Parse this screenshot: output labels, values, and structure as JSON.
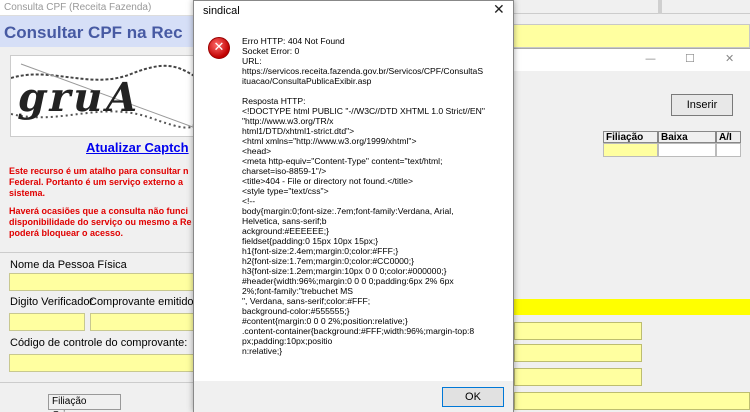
{
  "bg_window": {
    "inserir_label": "Inserir",
    "grid_headers": [
      "Filiação",
      "Baixa",
      "A/I"
    ],
    "minimize": "—",
    "maximize": "☐",
    "close": "✕",
    "filiacao_origem_label": "Filiação Origem"
  },
  "left_window": {
    "title": "Consulta CPF (Receita Fazenda)",
    "heading": "Consultar CPF na Rec",
    "captcha_text": "gruA",
    "refresh_link": "Atualizar Captch",
    "warning1": "Este recurso é um atalho para consultar n\nFederal. Portanto é um serviço externo a\nsistema.",
    "warning2": "Haverá ocasiões que a consulta não funci\ndisponibilidade do serviço ou mesmo a Re\npoderá bloquear o acesso.",
    "name_label": "Nome da Pessoa Física",
    "digit_label": "Digito Verificador",
    "comprovante_label": "Comprovante emitido á",
    "control_code_label": "Código de controle do comprovante:"
  },
  "dialog": {
    "title": "sindical",
    "close": "✕",
    "message": "Erro HTTP: 404 Not Found\nSocket Error: 0\nURL:\nhttps://servicos.receita.fazenda.gov.br/Servicos/CPF/ConsultaS\nituacao/ConsultaPublicaExibir.asp\n\nResposta HTTP:\n<!DOCTYPE html PUBLIC \"-//W3C//DTD XHTML 1.0 Strict//EN\"\n\"http://www.w3.org/TR/x\nhtml1/DTD/xhtml1-strict.dtd\">\n<html xmlns=\"http://www.w3.org/1999/xhtml\">\n<head>\n<meta http-equiv=\"Content-Type\" content=\"text/html;\ncharset=iso-8859-1\"/>\n<title>404 - File or directory not found.</title>\n<style type=\"text/css\">\n<!--\nbody{margin:0;font-size:.7em;font-family:Verdana, Arial,\nHelvetica, sans-serif;b\nackground:#EEEEEE;}\nfieldset{padding:0 15px 10px 15px;}\nh1{font-size:2.4em;margin:0;color:#FFF;}\nh2{font-size:1.7em;margin:0;color:#CC0000;}\nh3{font-size:1.2em;margin:10px 0 0 0;color:#000000;}\n#header{width:96%;margin:0 0 0 0;padding:6px 2% 6px\n2%;font-family:\"trebuchet MS\n\", Verdana, sans-serif;color:#FFF;\nbackground-color:#555555;}\n#content{margin:0 0 0 2%;position:relative;}\n.content-container{background:#FFF;width:96%;margin-top:8\npx;padding:10px;positio\nn:relative;}",
    "ok_label": "OK",
    "error_icon_glyph": "✕"
  }
}
